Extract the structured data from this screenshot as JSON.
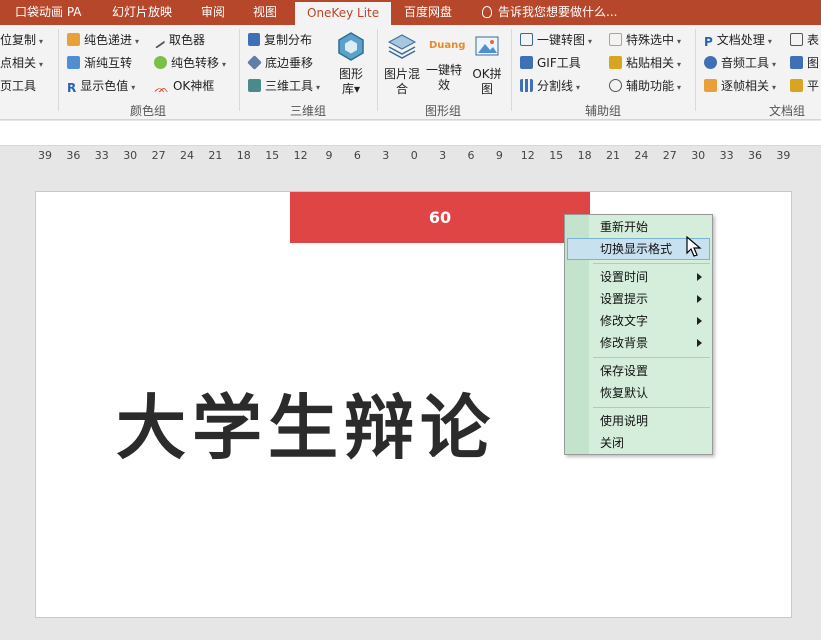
{
  "tabs": [
    {
      "label": "口袋动画 PA",
      "active": false
    },
    {
      "label": "幻灯片放映",
      "active": false
    },
    {
      "label": "审阅",
      "active": false
    },
    {
      "label": "视图",
      "active": false
    },
    {
      "label": "OneKey Lite",
      "active": true
    },
    {
      "label": "百度网盘",
      "active": false
    }
  ],
  "tell_me": "告诉我您想要做什么...",
  "ribbon": {
    "col0": [
      "位复制",
      "点相关",
      "页工具"
    ],
    "color_group": {
      "label": "颜色组",
      "items": [
        "纯色递进",
        "渐纯互转",
        "显示色值",
        "取色器",
        "纯色转移",
        "OK神框"
      ]
    },
    "three_d_group": {
      "label": "三维组",
      "items": [
        "复制分布",
        "底边垂移",
        "三维工具"
      ],
      "big": "图形库"
    },
    "shape_group": {
      "label": "图形组",
      "big": [
        "图片混合",
        "一键特效",
        "OK拼图"
      ],
      "duang": "Duang"
    },
    "assist_group": {
      "label": "辅助组",
      "items": [
        "一键转图",
        "GIF工具",
        "分割线",
        "特殊选中",
        "粘贴相关",
        "辅助功能"
      ]
    },
    "doc_group": {
      "label": "文档组",
      "items": [
        "文档处理",
        "音频工具",
        "逐帧相关"
      ],
      "edge": [
        "表",
        "图",
        "平"
      ]
    }
  },
  "ruler": [
    "39",
    "36",
    "33",
    "30",
    "27",
    "24",
    "21",
    "18",
    "15",
    "12",
    "9",
    "6",
    "3",
    "0",
    "3",
    "6",
    "9",
    "12",
    "15",
    "18",
    "21",
    "24",
    "27",
    "30",
    "33",
    "36",
    "39"
  ],
  "slide": {
    "timer_value": "60",
    "title": "大学生辩论"
  },
  "context_menu": {
    "items": [
      {
        "label": "重新开始",
        "submenu": false
      },
      {
        "label": "切换显示格式",
        "submenu": false,
        "highlighted": true
      },
      {
        "label": "设置时间",
        "submenu": true
      },
      {
        "label": "设置提示",
        "submenu": true
      },
      {
        "label": "修改文字",
        "submenu": true
      },
      {
        "label": "修改背景",
        "submenu": true
      },
      {
        "label": "保存设置",
        "submenu": false
      },
      {
        "label": "恢复默认",
        "submenu": false
      },
      {
        "label": "使用说明",
        "submenu": false
      },
      {
        "label": "关闭",
        "submenu": false
      }
    ]
  },
  "colors": {
    "accent": "#b7472a",
    "timer_bar": "#e04545",
    "menu_bg": "#d4eedb",
    "menu_highlight": "#c8e1ef"
  }
}
